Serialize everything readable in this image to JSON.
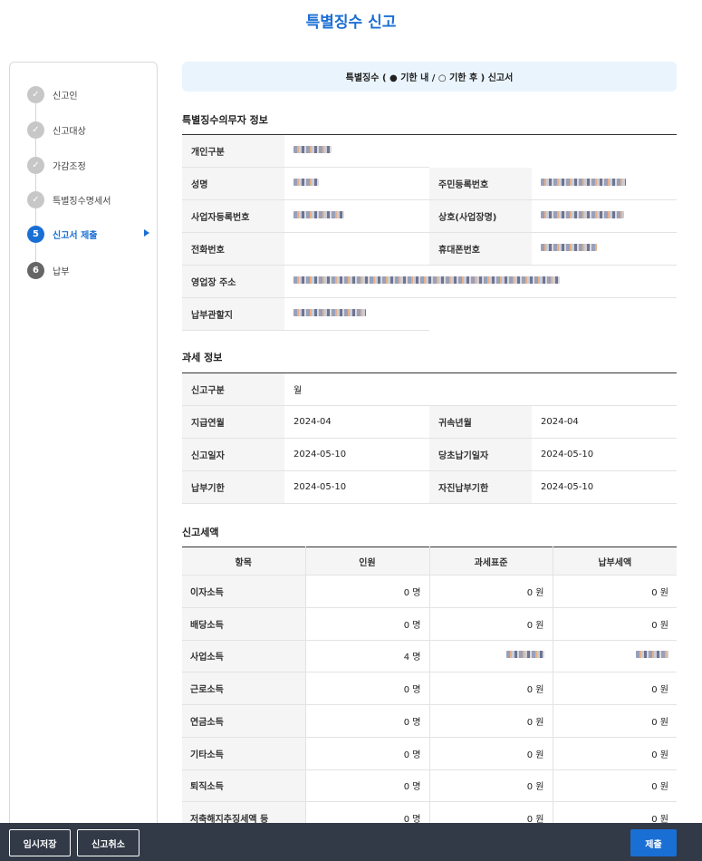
{
  "page": {
    "title": "특별징수 신고"
  },
  "steps": [
    {
      "num": "✓",
      "label": "신고인",
      "state": "done"
    },
    {
      "num": "✓",
      "label": "신고대상",
      "state": "done"
    },
    {
      "num": "✓",
      "label": "가감조정",
      "state": "done"
    },
    {
      "num": "✓",
      "label": "특별징수명세서",
      "state": "done"
    },
    {
      "num": "5",
      "label": "신고서 제출",
      "state": "active"
    },
    {
      "num": "6",
      "label": "납부",
      "state": "future"
    }
  ],
  "banner": {
    "text": "특별징수 ( ● 기한 내 / ○ 기한 후 ) 신고서"
  },
  "obligor": {
    "title": "특별징수의무자 정보",
    "labels": {
      "type": "개인구분",
      "name": "성명",
      "rrn": "주민등록번호",
      "brn": "사업자등록번호",
      "company": "상호(사업장명)",
      "phone": "전화번호",
      "mobile": "휴대폰번호",
      "address": "영업장 주소",
      "jurisdiction": "납부관할지"
    }
  },
  "tax_info": {
    "title": "과세 정보",
    "labels": {
      "report_type": "신고구분",
      "pay_month": "지급연월",
      "belong_month": "귀속년월",
      "report_date": "신고일자",
      "orig_due": "당초납기일자",
      "due_date": "납부기한",
      "self_due": "자진납부기한"
    },
    "values": {
      "report_type": "월",
      "pay_month": "2024-04",
      "belong_month": "2024-04",
      "report_date": "2024-05-10",
      "orig_due": "2024-05-10",
      "due_date": "2024-05-10",
      "self_due": "2024-05-10"
    }
  },
  "amounts": {
    "title": "신고세액",
    "headers": [
      "항목",
      "인원",
      "과세표준",
      "납부세액"
    ],
    "rows": [
      {
        "item": "이자소득",
        "people": "0 명",
        "base": "0 원",
        "tax": "0 원"
      },
      {
        "item": "배당소득",
        "people": "0 명",
        "base": "0 원",
        "tax": "0 원"
      },
      {
        "item": "사업소득",
        "people": "4 명",
        "base": "",
        "tax": ""
      },
      {
        "item": "근로소득",
        "people": "0 명",
        "base": "0 원",
        "tax": "0 원"
      },
      {
        "item": "연금소득",
        "people": "0 명",
        "base": "0 원",
        "tax": "0 원"
      },
      {
        "item": "기타소득",
        "people": "0 명",
        "base": "0 원",
        "tax": "0 원"
      },
      {
        "item": "퇴직소득",
        "people": "0 명",
        "base": "0 원",
        "tax": "0 원"
      },
      {
        "item": "저축해지추징세액 등",
        "people": "0 명",
        "base": "0 원",
        "tax": "0 원"
      }
    ]
  },
  "actions": {
    "temp_save": "임시저장",
    "cancel": "신고취소",
    "submit": "제출"
  }
}
